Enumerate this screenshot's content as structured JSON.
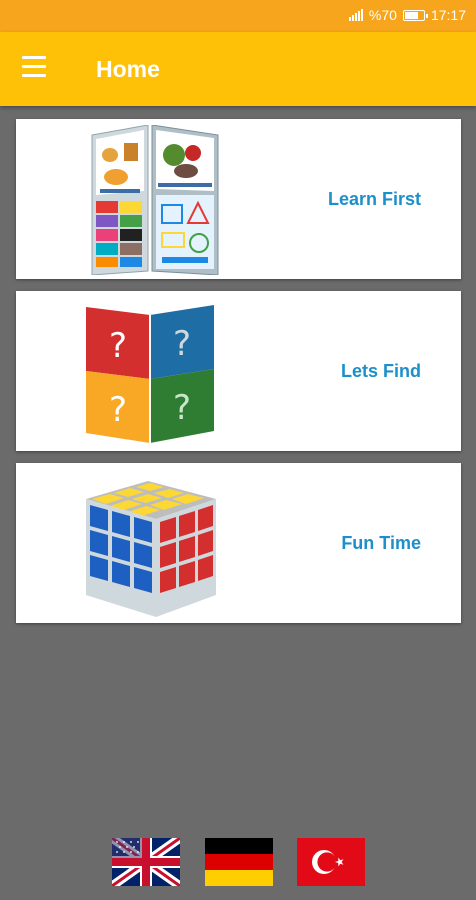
{
  "status_bar": {
    "battery": "%70",
    "battery_level": 0.7,
    "time": "17:17",
    "network_icon": "signal-bars-icon",
    "colors": {
      "background": "#f7a51c"
    }
  },
  "app_bar": {
    "title": "Home",
    "menu_icon": "hamburger-menu-icon",
    "colors": {
      "background": "#ffc107",
      "title": "#ffffff"
    }
  },
  "menu": {
    "items": [
      {
        "label": "Learn First",
        "image": "flashcards-image"
      },
      {
        "label": "Lets Find",
        "image": "question-cube-image"
      },
      {
        "label": "Fun Time",
        "image": "rubiks-cube-image"
      }
    ],
    "label_color": "#1d8fc9"
  },
  "languages": [
    {
      "name": "english",
      "icon": "uk-flag-icon"
    },
    {
      "name": "german",
      "icon": "germany-flag-icon"
    },
    {
      "name": "turkish",
      "icon": "turkey-flag-icon"
    }
  ]
}
